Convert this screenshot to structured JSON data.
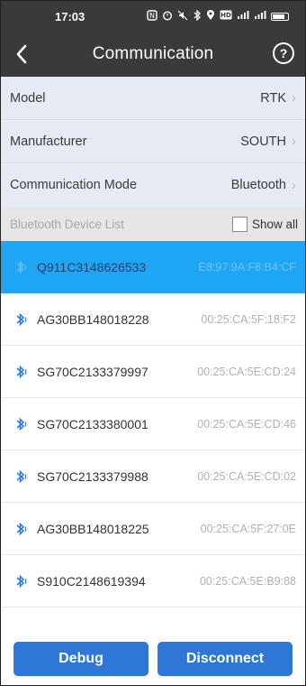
{
  "status_bar": {
    "time": "17:03",
    "icons": [
      "nfc-icon",
      "alarm-icon",
      "mute-icon",
      "bluetooth-icon",
      "location-icon",
      "hd-icon",
      "signal-icon",
      "signal-icon",
      "battery-icon"
    ]
  },
  "header": {
    "title": "Communication",
    "back_icon": "chevron-left-icon",
    "help_label": "?"
  },
  "settings": [
    {
      "label": "Model",
      "value": "RTK"
    },
    {
      "label": "Manufacturer",
      "value": "SOUTH"
    },
    {
      "label": "Communication Mode",
      "value": "Bluetooth"
    }
  ],
  "device_list": {
    "title": "Bluetooth Device List",
    "show_all_label": "Show all",
    "show_all_checked": false,
    "devices": [
      {
        "name": "Q911C3148626533",
        "mac": "E8:97:9A:F8:B4:CF",
        "selected": true
      },
      {
        "name": "AG30BB148018228",
        "mac": "00:25:CA:5F:18:F2",
        "selected": false
      },
      {
        "name": "SG70C2133379997",
        "mac": "00:25:CA:5E:CD:24",
        "selected": false
      },
      {
        "name": "SG70C2133380001",
        "mac": "00:25:CA:5E:CD:46",
        "selected": false
      },
      {
        "name": "SG70C2133379988",
        "mac": "00:25:CA:5E:CD:02",
        "selected": false
      },
      {
        "name": "AG30BB148018225",
        "mac": "00:25:CA:5F:27:0E",
        "selected": false
      },
      {
        "name": "S910C2148619394",
        "mac": "00:25:CA:5E:B9:88",
        "selected": false
      }
    ]
  },
  "buttons": {
    "debug_label": "Debug",
    "disconnect_label": "Disconnect"
  },
  "colors": {
    "header_bg": "#3a3a3c",
    "settings_bg": "#e6eaf4",
    "selected_row": "#1ea6f4",
    "button_blue": "#2f77d6",
    "bluetooth_icon": "#2f77d6"
  }
}
